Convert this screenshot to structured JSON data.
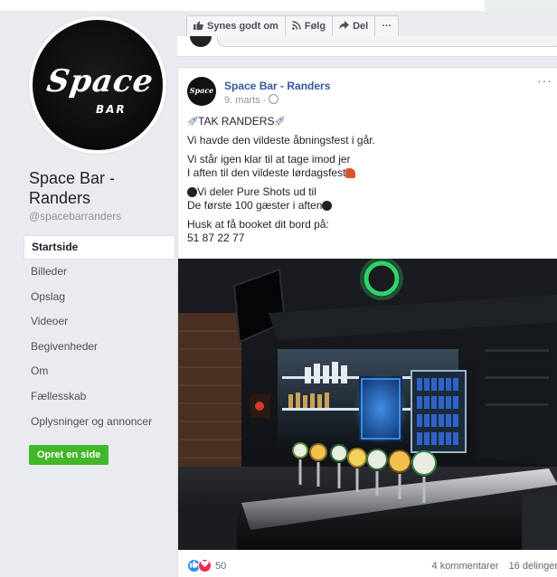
{
  "page": {
    "name": "Space Bar - Randers",
    "handle": "@spacebarranders",
    "logo_main": "Space",
    "logo_sub": "BAR"
  },
  "sidebar": {
    "items": [
      {
        "label": "Startside",
        "active": true
      },
      {
        "label": "Billeder"
      },
      {
        "label": "Opslag"
      },
      {
        "label": "Videoer"
      },
      {
        "label": "Begivenheder"
      },
      {
        "label": "Om"
      },
      {
        "label": "Fællesskab"
      },
      {
        "label": "Oplysninger og annoncer"
      }
    ],
    "create_button": "Opret en side"
  },
  "action_bar": {
    "like": "Synes godt om",
    "follow": "Følg",
    "share": "Del",
    "more": "···"
  },
  "post": {
    "author": "Space Bar - Randers",
    "date": "9. marts ·",
    "avatar_text": "Space",
    "more": "···",
    "lines": {
      "l1": "TAK RANDERS",
      "l2": "Vi havde den vildeste åbningsfest i går.",
      "l3a": "Vi står igen klar til at tage imod jer",
      "l3b": "I aften til den vildeste lørdagsfest",
      "l4a": "Vi deler Pure Shots ud til",
      "l4b": "De første 100 gæster i aften",
      "l5a": "Husk at få booket dit bord på:",
      "l5b": "51 87 22 77"
    },
    "reactions_count": "50",
    "comments": "4 kommentarer",
    "shares": "16 delinger"
  },
  "colors": {
    "link": "#365899",
    "green": "#42b72a",
    "like_blue": "#2e8ef0",
    "love_red": "#f0284a"
  },
  "icons": [
    "thumbs-up-icon",
    "rss-icon",
    "share-arrow-icon",
    "globe-icon",
    "rocket-icon",
    "black-circle-icon",
    "flexed-arm-icon"
  ]
}
